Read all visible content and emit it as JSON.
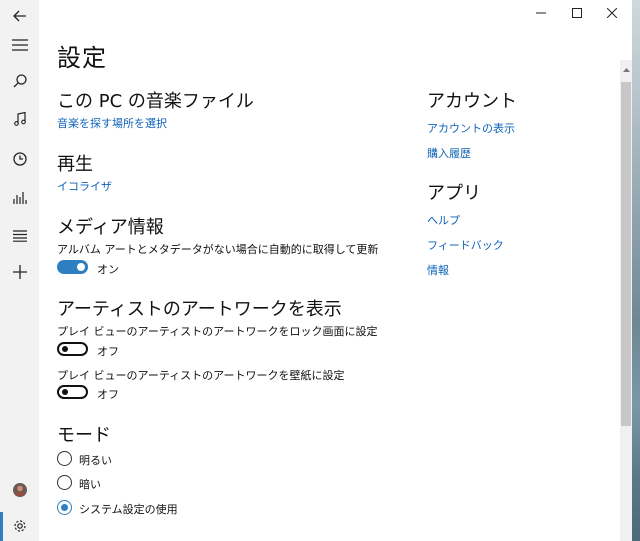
{
  "title": "設定",
  "sections": {
    "music_files": {
      "heading": "この PC の音楽ファイル",
      "link": "音楽を探す場所を選択"
    },
    "playback": {
      "heading": "再生",
      "link": "イコライザ"
    },
    "media_info": {
      "heading": "メディア情報",
      "description": "アルバム アートとメタデータがない場合に自動的に取得して更新",
      "toggle_state": "オン"
    },
    "artist_art": {
      "heading": "アーティストのアートワークを表示",
      "lock_label": "プレイ ビューのアーティストのアートワークをロック画面に設定",
      "lock_state": "オフ",
      "wallpaper_label": "プレイ ビューのアーティストのアートワークを壁紙に設定",
      "wallpaper_state": "オフ"
    },
    "mode": {
      "heading": "モード",
      "options": [
        "明るい",
        "暗い",
        "システム設定の使用"
      ],
      "selected": "システム設定の使用"
    }
  },
  "account": {
    "heading": "アカウント",
    "links": [
      "アカウントの表示",
      "購入履歴"
    ]
  },
  "app": {
    "heading": "アプリ",
    "links": [
      "ヘルプ",
      "フィードバック",
      "情報"
    ]
  },
  "nav_icons": [
    "back-icon",
    "hamburger-menu-icon",
    "search-icon",
    "music-note-icon",
    "clock-icon",
    "equalizer-icon",
    "playlist-icon",
    "add-icon",
    "avatar",
    "settings-gear-icon"
  ],
  "colors": {
    "accent": "#2d7fc1",
    "link": "#0f63b8",
    "rail": "#f2f2f2"
  }
}
